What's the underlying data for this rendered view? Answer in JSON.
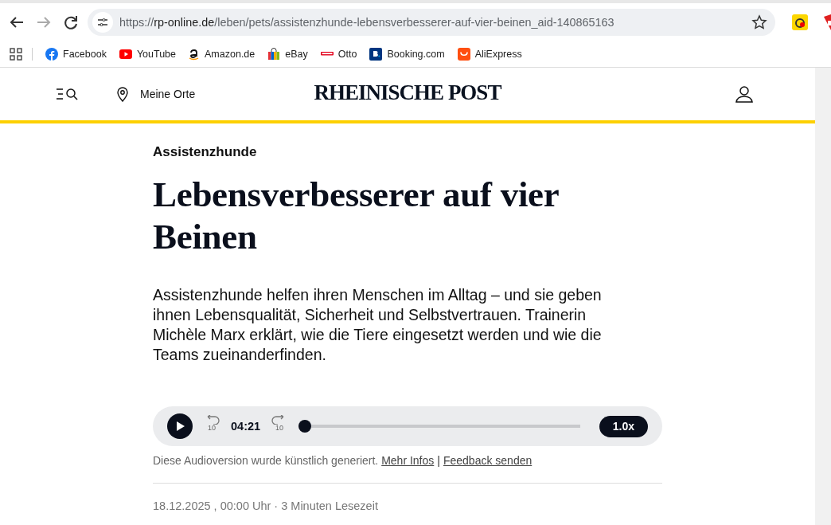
{
  "browser": {
    "url_prefix": "https://",
    "url_host": "rp-online.de",
    "url_path": "/leben/pets/assistenzhunde-lebensverbesserer-auf-vier-beinen_aid-140865163",
    "bookmarks": [
      {
        "kind": "facebook",
        "label": "Facebook"
      },
      {
        "kind": "youtube",
        "label": "YouTube"
      },
      {
        "kind": "amazon",
        "label": "Amazon.de"
      },
      {
        "kind": "ebay",
        "label": "eBay"
      },
      {
        "kind": "otto",
        "label": "Otto"
      },
      {
        "kind": "booking",
        "label": "Booking.com"
      },
      {
        "kind": "aliexpress",
        "label": "AliExpress"
      }
    ]
  },
  "site_header": {
    "places": "Meine Orte",
    "logo": "RHEINISCHE POST"
  },
  "article": {
    "kicker": "Assistenzhunde",
    "headline": "Lebensverbesserer auf vier Beinen",
    "teaser": "Assistenzhunde helfen ihren Menschen im Alltag – und sie geben ihnen Lebensqualität, Sicherheit und Selbstvertrauen. Trainerin Michèle Marx erklärt, wie die Tiere eingesetzt werden und wie die Teams zueinanderfinden.",
    "audio": {
      "playing": false,
      "skip_back": "10",
      "time": "04:21",
      "skip_forward": "10",
      "level": 0,
      "speed": "1.0x"
    },
    "audio_note": "Diese Audioversion wurde künstlich generiert.",
    "more_info": "Mehr Infos",
    "separator": "|",
    "feedback": "Feedback senden",
    "meta": "18.12.2025 , 00:00 Uhr · 3 Minuten Lesezeit"
  }
}
